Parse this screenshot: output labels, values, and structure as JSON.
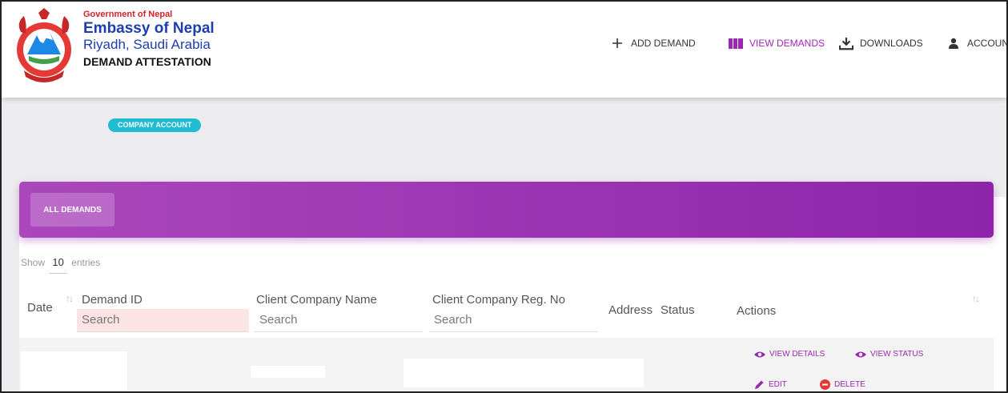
{
  "header": {
    "gov": "Government of Nepal",
    "embassy": "Embassy of Nepal",
    "location": "Riyadh, Saudi Arabia",
    "app_title": "DEMAND ATTESTATION",
    "logo_icon": "nepal-emblem-icon"
  },
  "nav": {
    "add_demand": "ADD DEMAND",
    "view_demands": "VIEW DEMANDS",
    "downloads": "DOWNLOADS",
    "account": "ACCOUNT",
    "active_color": "#9c27b0"
  },
  "badge": {
    "label": "COMPANY ACCOUNT",
    "color": "#1fbcd2"
  },
  "card": {
    "tab_label": "ALL DEMANDS",
    "gradient_from": "#ab47bc",
    "gradient_to": "#8e24aa"
  },
  "table": {
    "show_label": "Show",
    "entries_value": "10",
    "entries_label": "entries",
    "columns": {
      "date": "Date",
      "demand_id": "Demand ID",
      "client_name": "Client Company Name",
      "client_reg": "Client Company Reg. No",
      "address": "Address",
      "status": "Status",
      "actions": "Actions"
    },
    "search_placeholder": "Search",
    "actions": {
      "view_details": "VIEW DETAILS",
      "view_status": "VIEW STATUS",
      "edit": "EDIT",
      "delete": "DELETE"
    }
  }
}
